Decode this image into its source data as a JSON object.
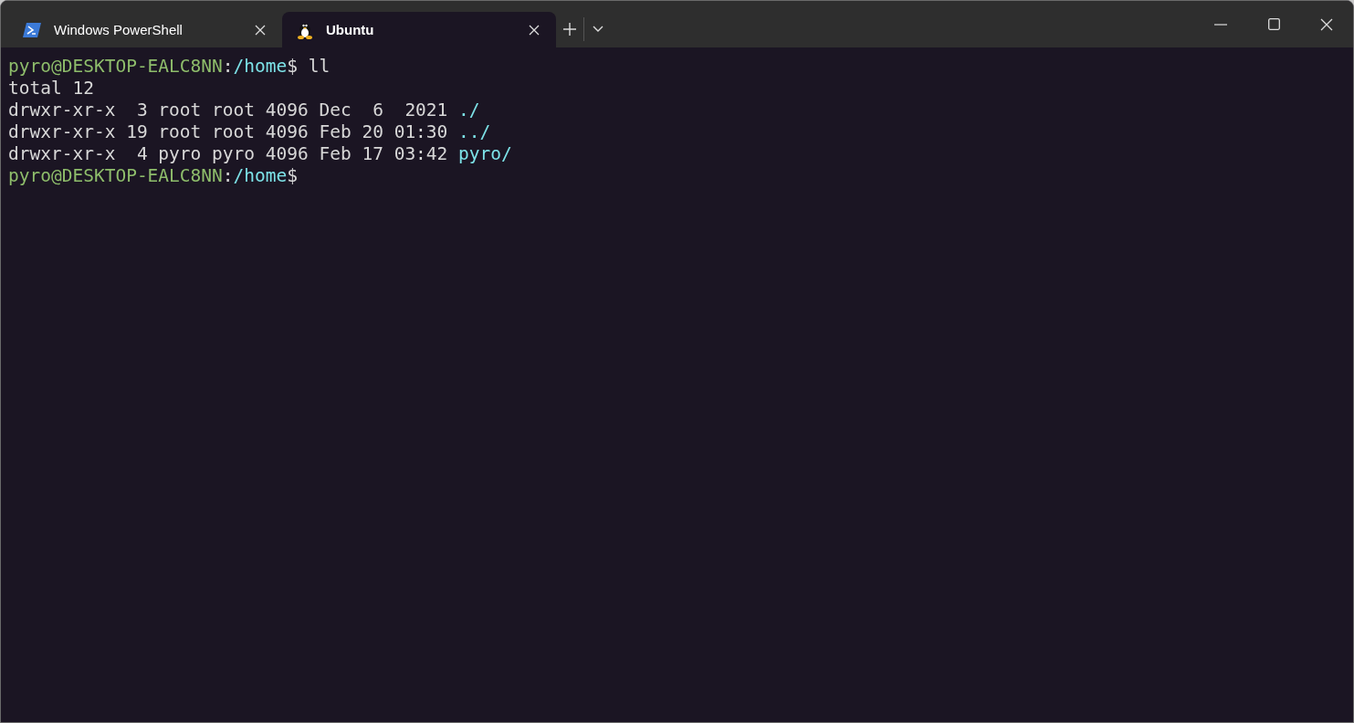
{
  "tabs": [
    {
      "label": "Windows PowerShell",
      "kind": "powershell",
      "selected": false
    },
    {
      "label": "Ubuntu",
      "kind": "linux",
      "selected": true
    }
  ],
  "terminal": {
    "lines": [
      [
        {
          "text": "pyro@DESKTOP-EALC8NN",
          "kind": "user"
        },
        {
          "text": ":",
          "kind": "plain"
        },
        {
          "text": "/home",
          "kind": "path"
        },
        {
          "text": "$ ll",
          "kind": "plain"
        }
      ],
      [
        {
          "text": "total 12",
          "kind": "plain"
        }
      ],
      [
        {
          "text": "drwxr-xr-x  3 root root 4096 Dec  6  2021 ",
          "kind": "plain"
        },
        {
          "text": "./",
          "kind": "dir"
        }
      ],
      [
        {
          "text": "drwxr-xr-x 19 root root 4096 Feb 20 01:30 ",
          "kind": "plain"
        },
        {
          "text": "../",
          "kind": "dir"
        }
      ],
      [
        {
          "text": "drwxr-xr-x  4 pyro pyro 4096 Feb 17 03:42 ",
          "kind": "plain"
        },
        {
          "text": "pyro/",
          "kind": "dir"
        }
      ],
      [
        {
          "text": "pyro@DESKTOP-EALC8NN",
          "kind": "user"
        },
        {
          "text": ":",
          "kind": "plain"
        },
        {
          "text": "/home",
          "kind": "path"
        },
        {
          "text": "$",
          "kind": "plain"
        }
      ]
    ]
  }
}
